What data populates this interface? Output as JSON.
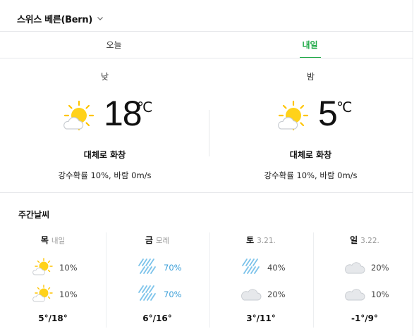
{
  "location": {
    "name": "스위스 베른(Bern)"
  },
  "tabs": [
    {
      "label": "오늘",
      "active": false
    },
    {
      "label": "내일",
      "active": true
    }
  ],
  "day": {
    "label": "낮",
    "temp": "18",
    "unit": "℃",
    "icon": "partly-sunny-icon",
    "desc": "대체로 화창",
    "sub": "강수확률 10%, 바람 0m/s"
  },
  "night": {
    "label": "밤",
    "temp": "5",
    "unit": "℃",
    "icon": "partly-sunny-icon",
    "desc": "대체로 화창",
    "sub": "강수확률 10%, 바람 0m/s"
  },
  "weekly": {
    "title": "주간날씨",
    "days": [
      {
        "day": "목",
        "sub": "내일",
        "am": {
          "icon": "partly-sunny-icon",
          "pct": "10%",
          "rain": false
        },
        "pm": {
          "icon": "partly-sunny-icon",
          "pct": "10%",
          "rain": false
        },
        "range": "5°/18°"
      },
      {
        "day": "금",
        "sub": "모레",
        "am": {
          "icon": "rain-icon",
          "pct": "70%",
          "rain": true
        },
        "pm": {
          "icon": "rain-icon",
          "pct": "70%",
          "rain": true
        },
        "range": "6°/16°"
      },
      {
        "day": "토",
        "sub": "3.21.",
        "am": {
          "icon": "rain-icon",
          "pct": "40%",
          "rain": false
        },
        "pm": {
          "icon": "cloudy-icon",
          "pct": "20%",
          "rain": false
        },
        "range": "3°/11°"
      },
      {
        "day": "일",
        "sub": "3.22.",
        "am": {
          "icon": "cloudy-icon",
          "pct": "20%",
          "rain": false
        },
        "pm": {
          "icon": "cloudy-icon",
          "pct": "10%",
          "rain": false
        },
        "range": "-1°/9°"
      }
    ]
  },
  "colors": {
    "accent": "#1ea946",
    "rain": "#3b9fd8",
    "sun": "#ffd21a",
    "cloud": "#e6e8eb"
  }
}
